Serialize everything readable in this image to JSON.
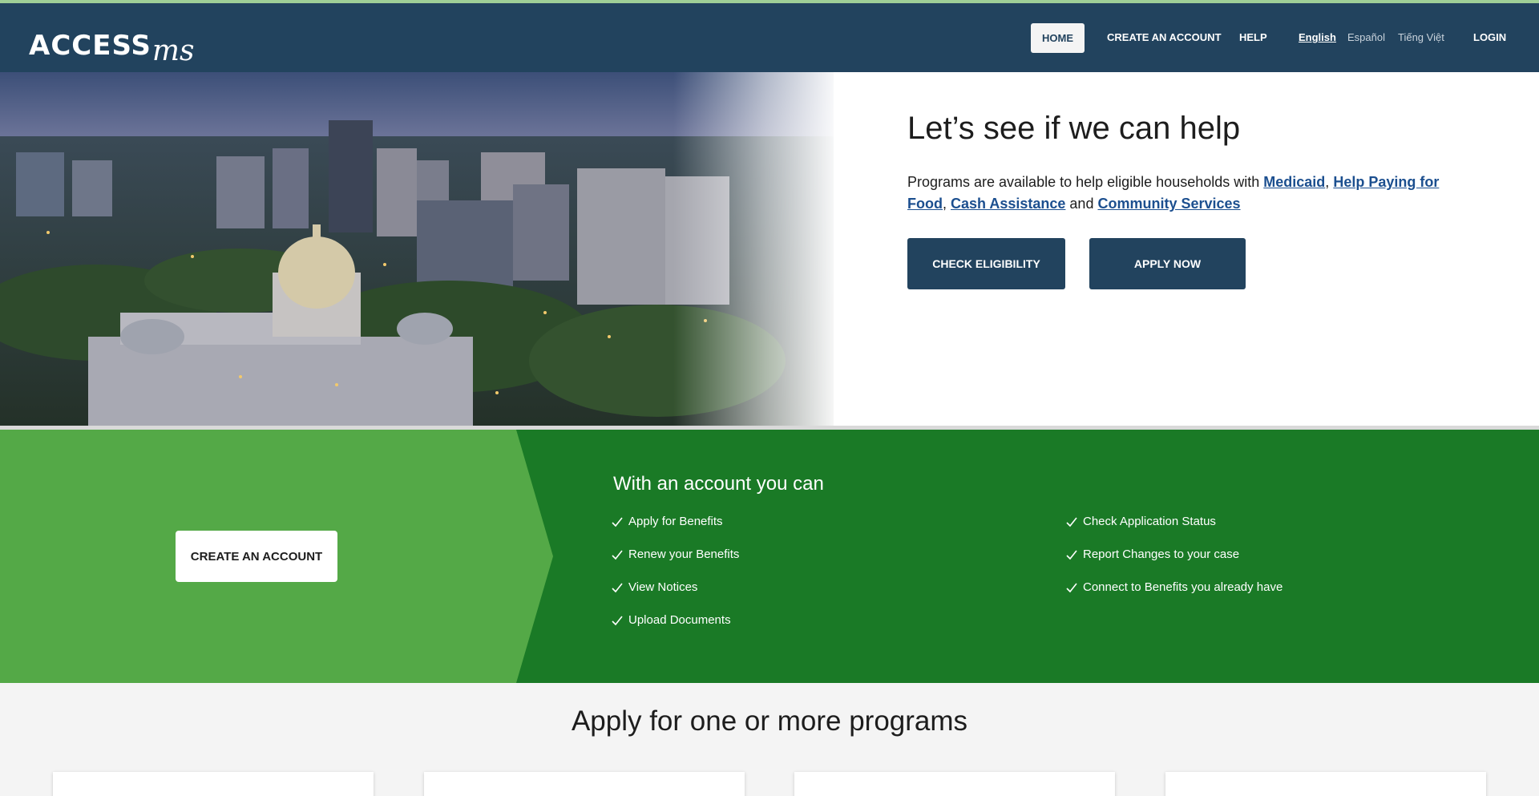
{
  "brand": {
    "logo_main": "ACCESS",
    "logo_suffix": "ms"
  },
  "nav": {
    "home": "HOME",
    "create_account": "CREATE AN ACCOUNT",
    "help": "HELP",
    "languages": [
      "English",
      "Español",
      "Tiếng Việt"
    ],
    "login": "LOGIN"
  },
  "hero": {
    "title": "Let’s see if we can help",
    "text_prefix": "Programs are available to help eligible households with ",
    "links": [
      "Medicaid",
      "Help Paying for Food",
      "Cash Assistance",
      "Community Services"
    ],
    "sep_comma": ",",
    "sep_and": " and ",
    "check_eligibility": "CHECK ELIGIBILITY",
    "apply_now": "APPLY NOW"
  },
  "account": {
    "create_button": "CREATE AN ACCOUNT",
    "title": "With an account you can",
    "features_left": [
      "Apply for Benefits",
      "Renew your Benefits",
      "View Notices",
      "Upload Documents"
    ],
    "features_right": [
      "Check Application Status",
      "Report Changes to your case",
      "Connect to Benefits you already have"
    ]
  },
  "programs": {
    "title": "Apply for one or more programs"
  },
  "colors": {
    "header": "#22435e",
    "band_dark": "#1a7a26",
    "band_light": "#54a947",
    "link": "#1c4f8f"
  }
}
